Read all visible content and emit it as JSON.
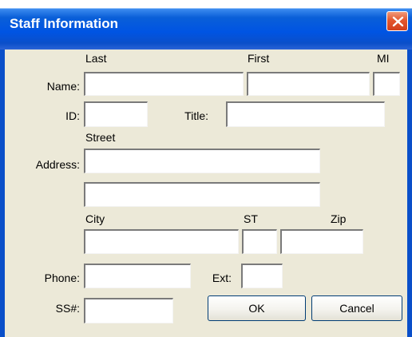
{
  "window": {
    "title": "Staff Information"
  },
  "icons": {
    "close": "close-icon"
  },
  "colors": {
    "titlebar": "#0054e3",
    "client": "#ece9d8",
    "close_button": "#e4572e"
  },
  "form": {
    "name": {
      "label": "Name:",
      "last_label": "Last",
      "first_label": "First",
      "mi_label": "MI",
      "last_value": "",
      "first_value": "",
      "mi_value": ""
    },
    "id": {
      "label": "ID:",
      "value": ""
    },
    "title": {
      "label": "Title:",
      "value": ""
    },
    "address": {
      "label": "Address:",
      "street_label": "Street",
      "street1_value": "",
      "street2_value": "",
      "city_label": "City",
      "st_label": "ST",
      "zip_label": "Zip",
      "city_value": "",
      "st_value": "",
      "zip_value": ""
    },
    "phone": {
      "label": "Phone:",
      "value": "",
      "ext_label": "Ext:",
      "ext_value": ""
    },
    "ssn": {
      "label": "SS#:",
      "value": ""
    }
  },
  "buttons": {
    "ok": "OK",
    "cancel": "Cancel"
  }
}
